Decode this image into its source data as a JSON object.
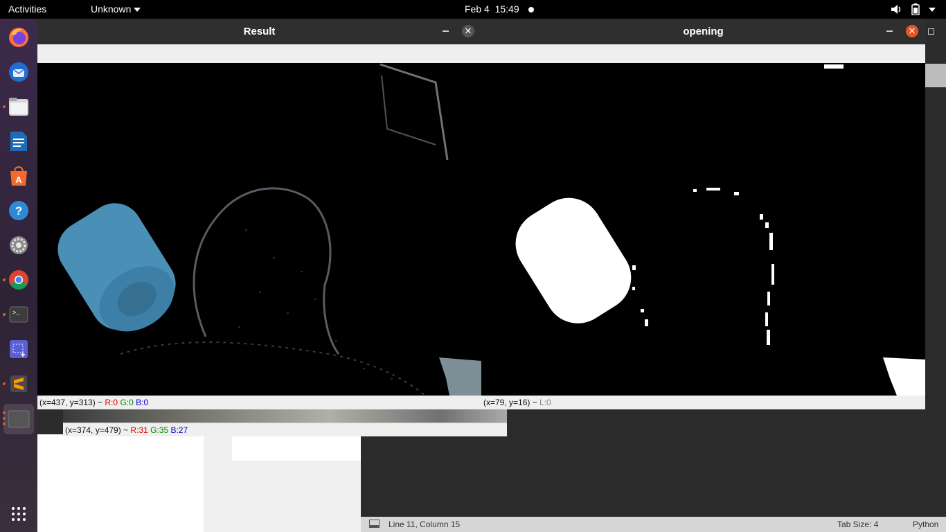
{
  "topbar": {
    "activities": "Activities",
    "app_menu": "Unknown",
    "date": "Feb 4",
    "time": "15:49"
  },
  "dock": {
    "items": [
      "firefox-icon",
      "thunderbird-icon",
      "files-icon",
      "writer-icon",
      "software-icon",
      "help-icon",
      "settings-icon",
      "chrome-icon",
      "terminal-icon",
      "screenshot-icon",
      "sublime-icon",
      "opencv-window-icon"
    ],
    "apps_grid": "show-applications-icon"
  },
  "windows": {
    "result": {
      "title": "Result",
      "status_coords": "(x=437, y=313) ~ ",
      "r": "R:0",
      "g": "G:0",
      "b": "B:0"
    },
    "opening": {
      "title": "opening",
      "status_coords": "(x=79, y=16) ~ ",
      "l": "L:0"
    },
    "behind": {
      "status_coords": "(x=374, y=479) ~ ",
      "r": "R:31",
      "g": "G:35",
      "b": "B:27"
    }
  },
  "editor_status": {
    "position": "Line 11, Column 15",
    "tab_size": "Tab Size: 4",
    "language": "Python"
  },
  "colors": {
    "accent": "#e95420",
    "close_active": "#e95420",
    "bottle": "#4a8fb5"
  }
}
